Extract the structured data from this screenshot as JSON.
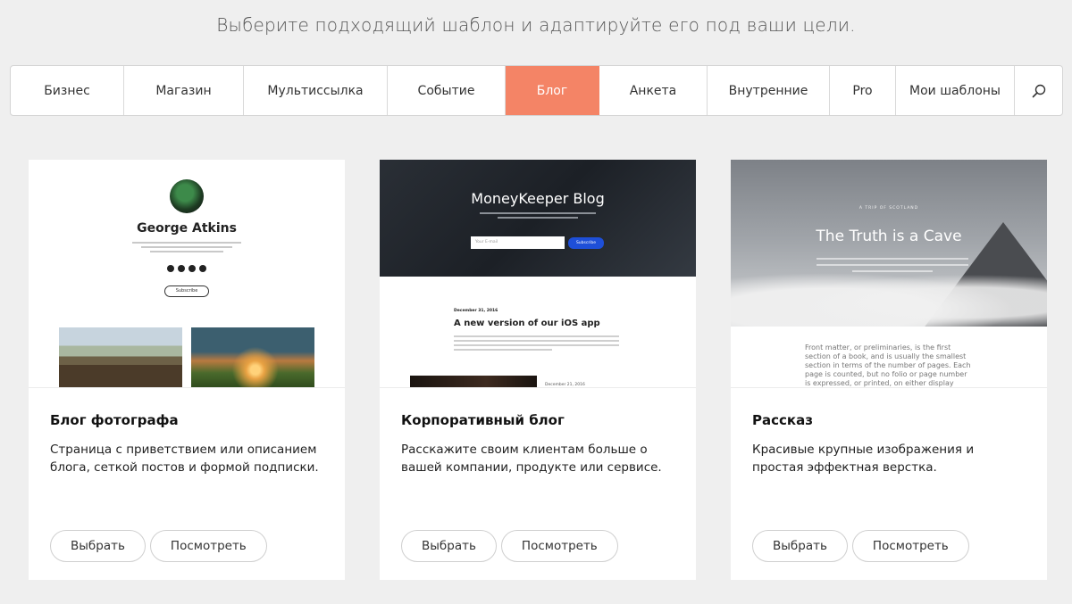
{
  "headline": "Выберите подходящий шаблон и адаптируйте его под ваши цели.",
  "tabs": [
    {
      "label": "Бизнес",
      "width": 127
    },
    {
      "label": "Магазин",
      "width": 134
    },
    {
      "label": "Мультиссылка",
      "width": 161
    },
    {
      "label": "Событие",
      "width": 132
    },
    {
      "label": "Блог",
      "width": 105,
      "active": true
    },
    {
      "label": "Анкета",
      "width": 121
    },
    {
      "label": "Внутренние",
      "width": 137
    },
    {
      "label": "Pro",
      "width": 74
    },
    {
      "label": "Мои шаблоны",
      "width": 133
    }
  ],
  "colors": {
    "accent": "#f48466",
    "background": "#efefef"
  },
  "search_icon": "search-icon",
  "cards": [
    {
      "title": "Блог фотографа",
      "description": "Страница с приветствием или описанием блога, сеткой постов и формой подписки.",
      "select_label": "Выбрать",
      "view_label": "Посмотреть",
      "preview": {
        "name": "George Atkins",
        "subscribe": "Subscribe"
      }
    },
    {
      "title": "Корпоративный блог",
      "description": "Расскажите своим клиентам больше о вашей компании, продукте или сервисе.",
      "select_label": "Выбрать",
      "view_label": "Посмотреть",
      "preview": {
        "title": "MoneyKeeper Blog",
        "email_placeholder": "Your E-mail",
        "subscribe": "Subscribe",
        "date": "December 31, 2016",
        "post_title": "A new version of our iOS app",
        "date2": "December 21, 2016"
      }
    },
    {
      "title": "Рассказ",
      "description": "Красивые крупные изображения и простая эффектная верстка.",
      "select_label": "Выбрать",
      "view_label": "Посмотреть",
      "preview": {
        "kicker": "A TRIP OF SCOTLAND",
        "title": "The Truth is a Cave",
        "text": "Front matter, or preliminaries, is the first section of a book, and is usually the smallest section in terms of the number of pages. Each page is counted, but no folio or page number is expressed, or printed, on either display pages or blank pages."
      }
    }
  ]
}
